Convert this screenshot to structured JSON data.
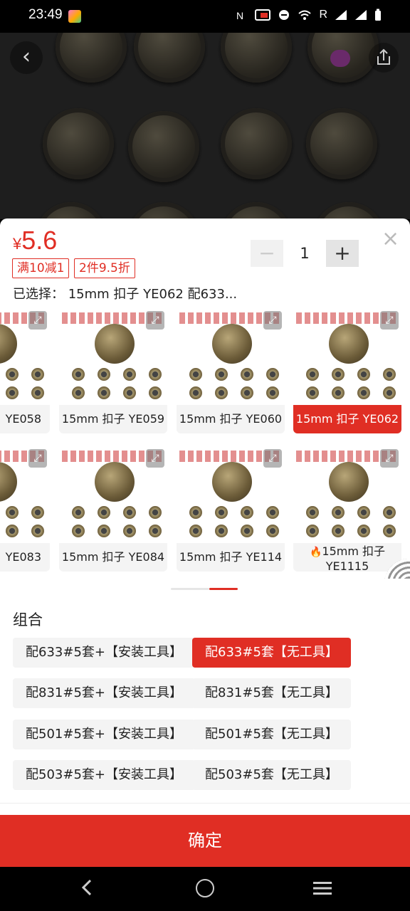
{
  "status": {
    "time": "23:49",
    "carrier_letter": "R"
  },
  "price": {
    "currency": "¥",
    "value": "5.6"
  },
  "promos": [
    "满10减1",
    "2件9.5折"
  ],
  "quantity": {
    "minus": "−",
    "value": "1",
    "plus": "+"
  },
  "close": "×",
  "selected": "已选择：  15mm 扣子 YE062 配633...",
  "variants": {
    "row1": [
      "YE058",
      "15mm 扣子 YE059",
      "15mm 扣子 YE060",
      "15mm 扣子 YE062"
    ],
    "row2": [
      "YE083",
      "15mm 扣子 YE084",
      "15mm 扣子 YE114",
      "15mm 扣子 YE1115"
    ],
    "row2_last_line1": "15mm 扣子",
    "row2_last_line2": "YE1115"
  },
  "combo": {
    "title": "组合",
    "options": [
      "配633#5套+【安装工具】",
      "配633#5套【无工具】",
      "配831#5套+【安装工具】",
      "配831#5套【无工具】",
      "配501#5套+【安装工具】",
      "配501#5套【无工具】",
      "配503#5套+【安装工具】",
      "配503#5套【无工具】"
    ]
  },
  "confirm": "确定",
  "colors": {
    "accent": "#e02e24"
  },
  "icons": [
    "back-icon",
    "share-icon",
    "close-icon",
    "expand-icon",
    "fire-icon",
    "nav-back-icon",
    "nav-home-icon",
    "nav-menu-icon"
  ]
}
